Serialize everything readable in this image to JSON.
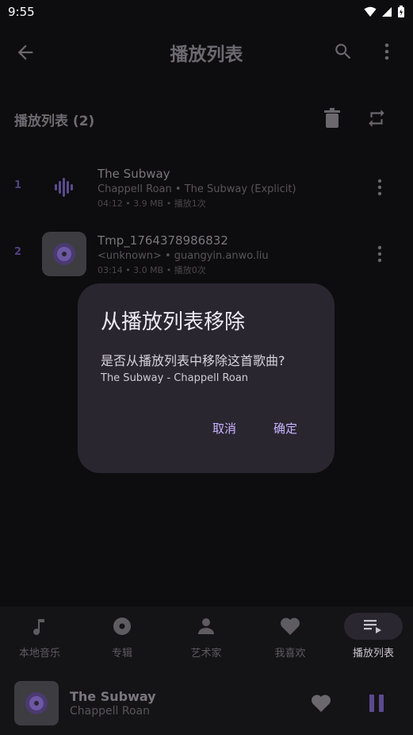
{
  "status": {
    "time": "9:55"
  },
  "app_bar": {
    "title": "播放列表"
  },
  "section": {
    "title": "播放列表 (2)"
  },
  "songs": [
    {
      "index": "1",
      "title": "The Subway",
      "subtitle": "Chappell Roan • The Subway (Explicit)",
      "meta": "04:12 • 3.9 MB • 播放1次",
      "art": "playing-waveform-icon"
    },
    {
      "index": "2",
      "title": "Tmp_1764378986832",
      "subtitle": "<unknown> • guangyin.anwo.liu",
      "meta": "03:14 • 3.0 MB • 播放0次",
      "art": "vinyl-disc-icon"
    }
  ],
  "dialog": {
    "title": "从播放列表移除",
    "message": "是否从播放列表中移除这首歌曲?",
    "song": "The Subway - Chappell Roan",
    "cancel": "取消",
    "confirm": "确定"
  },
  "nav": {
    "items": [
      {
        "label": "本地音乐",
        "icon": "music-note-icon"
      },
      {
        "label": "专辑",
        "icon": "album-icon"
      },
      {
        "label": "艺术家",
        "icon": "person-icon"
      },
      {
        "label": "我喜欢",
        "icon": "heart-icon"
      },
      {
        "label": "播放列表",
        "icon": "queue-music-icon",
        "active": true
      }
    ]
  },
  "player": {
    "title": "The Subway",
    "artist": "Chappell Roan"
  },
  "colors": {
    "accent": "#c9b3ff",
    "dialog_bg": "#2a2630",
    "background": "#0d0c0e"
  }
}
